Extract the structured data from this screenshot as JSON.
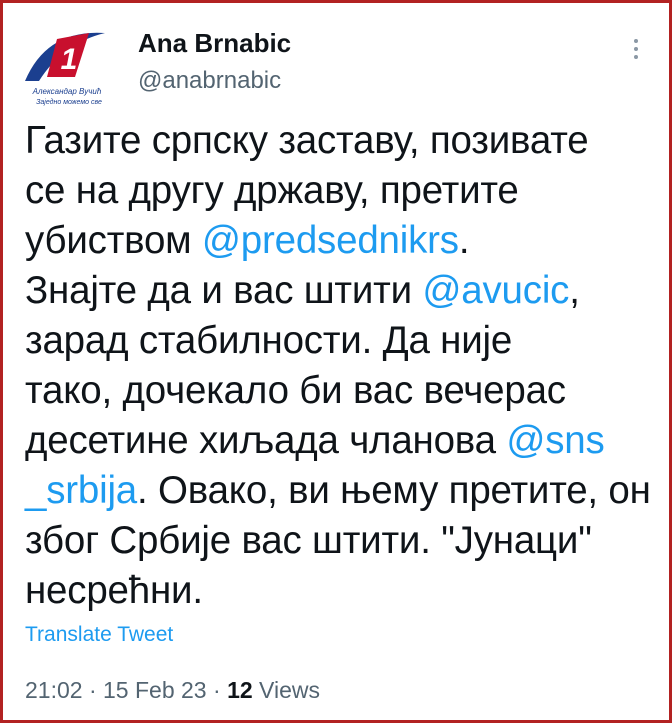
{
  "tweet": {
    "author_name": "Ana Brnabic",
    "author_handle": "@anabrnabic",
    "avatar": {
      "icon": "sns-logo-icon",
      "numeral": "1",
      "caption_line1": "Александар Вучић",
      "caption_line2": "Заједно можемо све",
      "brand_color": "#c8102e",
      "swoosh_color": "#1b3f8f"
    },
    "text_lines": [
      [
        {
          "t": "Газите српску заставу, позивате"
        }
      ],
      [
        {
          "t": "се на другу државу, претите"
        }
      ],
      [
        {
          "t": "убиством "
        },
        {
          "t": "@predsednikrs",
          "mention": true
        },
        {
          "t": "."
        }
      ],
      [
        {
          "t": "Знајте да и вас штити "
        },
        {
          "t": "@avucic",
          "mention": true
        },
        {
          "t": ","
        }
      ],
      [
        {
          "t": "зарад стабилности. Да није"
        }
      ],
      [
        {
          "t": "тако, дочекало би вас вечерас"
        }
      ],
      [
        {
          "t": "десетине хиљада чланова "
        },
        {
          "t": "@sns",
          "mention": true
        }
      ],
      [
        {
          "t": "_srbija",
          "mention": true
        },
        {
          "t": ". Овако, ви њему претите, он"
        }
      ],
      [
        {
          "t": "због Србије вас штити. \"Јунаци\""
        }
      ],
      [
        {
          "t": "несрећни."
        }
      ]
    ],
    "translate_label": "Translate Tweet",
    "time": "21:02",
    "separator": "·",
    "date": "15 Feb 23",
    "views_count": "12",
    "views_label": "Views",
    "more_icon": "more-options-icon",
    "link_color": "#1d9bf0",
    "border_color": "#b22222"
  }
}
